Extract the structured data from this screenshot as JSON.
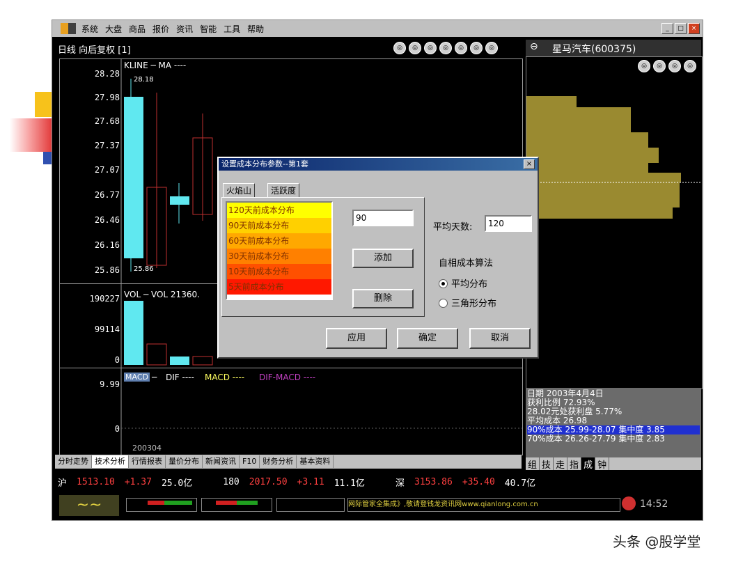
{
  "menu": {
    "items": [
      "系统",
      "大盘",
      "商品",
      "报价",
      "资讯",
      "智能",
      "工具",
      "帮助"
    ]
  },
  "chart": {
    "title": "日线 向后复权 [1]",
    "price_series_label": "KLINE  ─  MA ----",
    "price_axis": [
      "28.28",
      "27.98",
      "27.68",
      "27.37",
      "27.07",
      "26.77",
      "26.46",
      "26.16",
      "25.86"
    ],
    "high_label": "28.18",
    "low_label": "25.86",
    "vol_series_label": "VOL  ─  VOL 21360.",
    "vol_axis": [
      "190227",
      "99114",
      "0"
    ],
    "macd_label_box": "MACD",
    "macd_series": [
      "DIF ----",
      "MACD ----",
      "DIF-MACD ----"
    ],
    "macd_axis": [
      "9.99",
      "0"
    ],
    "date_label": "200304"
  },
  "bottom_tabs": [
    "分时走势",
    "技术分析",
    "行情报表",
    "量价分布",
    "新闻资讯",
    "F10",
    "财务分析",
    "基本资料"
  ],
  "right": {
    "stock_title": "星马汽车(600375)",
    "info_lines": [
      "日期 2003年4月4日",
      "获利比例 72.93%",
      "28.02元处获利盘 5.77%",
      "平均成本 26.98"
    ],
    "highlight_line": "90%成本 25.99-28.07 集中度 3.85",
    "last_line": "70%成本 26.26-27.79 集中度 2.83",
    "tabs": [
      "组",
      "技",
      "走",
      "指",
      "成",
      "钟"
    ]
  },
  "ticker": {
    "sh_label": "沪",
    "sh_index": "1513.10",
    "sh_change": "+1.37",
    "sh_amount": "25.0亿",
    "s180_label": "180",
    "s180_index": "2017.50",
    "s180_change": "+3.11",
    "s180_amount": "11.1亿",
    "sz_label": "深",
    "sz_index": "3153.86",
    "sz_change": "+35.40",
    "sz_amount": "40.7亿"
  },
  "status": {
    "scroll_text": "网际管家全集成》,敬请登钱龙资讯网www.qianlong.com.cn",
    "clock": "14:52"
  },
  "dialog": {
    "title": "设置成本分布参数--第1套",
    "tabs": [
      "火焰山",
      "活跃度"
    ],
    "list_items": [
      "120天前成本分布",
      "90天前成本分布",
      "60天前成本分布",
      "30天前成本分布",
      "10天前成本分布",
      "5天前成本分布"
    ],
    "list_colors": [
      "#ffff00",
      "#ffd000",
      "#ffa800",
      "#ff8000",
      "#ff5000",
      "#ff1800"
    ],
    "days_input": "90",
    "add_button": "添加",
    "delete_button": "删除",
    "avg_days_label": "平均天数:",
    "avg_days_input": "120",
    "algo_group": "自相成本算法",
    "radio_avg": "平均分布",
    "radio_tri": "三角形分布",
    "apply": "应用",
    "ok": "确定",
    "cancel": "取消"
  },
  "watermark": "头条 @股学堂",
  "colors": {
    "bull": "#60e8f0",
    "bear": "#c03030",
    "chip": "#9a8a30"
  }
}
